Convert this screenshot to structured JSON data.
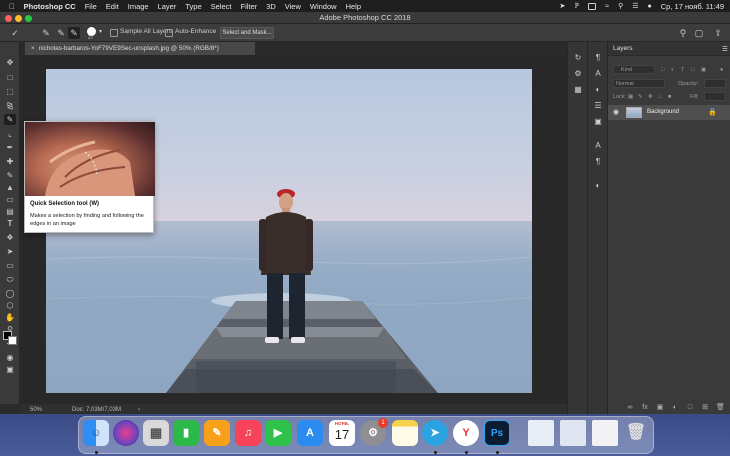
{
  "menubar": {
    "app_name": "Photoshop CC",
    "items": [
      "File",
      "Edit",
      "Image",
      "Layer",
      "Type",
      "Select",
      "Filter",
      "3D",
      "View",
      "Window",
      "Help"
    ],
    "clock": "Ср, 17 нояб.  11:49"
  },
  "window": {
    "title": "Adobe Photoshop CC 2018"
  },
  "options": {
    "brush_size": "27",
    "sample_all_layers": "Sample All Layers",
    "auto_enhance": "Auto-Enhance",
    "select_and_mask": "Select and Mask..."
  },
  "document": {
    "tab_title": "nicholas-barbaros-YoF79VE9Sec-unsplash.jpg @ 50% (RGB/8*)",
    "zoom": "50%",
    "doc_size": "Doc: 7,03M/7,03M"
  },
  "tooltip": {
    "title": "Quick Selection tool (W)",
    "description": "Makes a selection by finding and following the edges in an image"
  },
  "layers_panel": {
    "title": "Layers",
    "kind_placeholder": "Kind",
    "blend_mode": "Normal",
    "opacity_label": "Opacity:",
    "lock_label": "Lock:",
    "fill_label": "Fill:",
    "layers": [
      {
        "name": "Background"
      }
    ]
  },
  "dock": {
    "calendar_month": "НОЯБ.",
    "calendar_day": "17",
    "badge": "1"
  },
  "colors": {
    "accent": "#1473e6",
    "panel": "#3a3a3a",
    "canvas": "#282828"
  }
}
